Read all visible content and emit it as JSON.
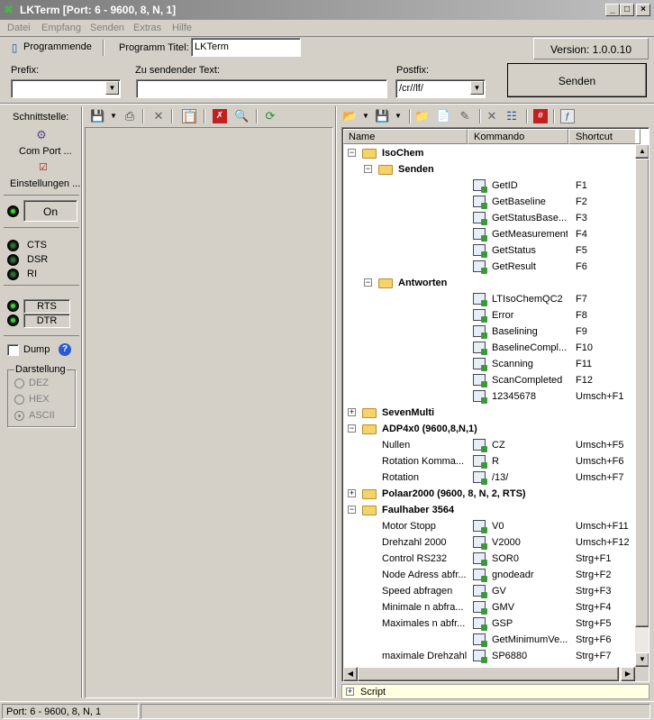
{
  "window": {
    "title": "LKTerm [Port: 6 - 9600, 8, N, 1]"
  },
  "menu": [
    "Datei",
    "Empfang",
    "Senden",
    "Extras",
    "Hilfe"
  ],
  "toolbar": {
    "programmende": "Programmende",
    "programm_titel_label": "Programm Titel:",
    "programm_titel_value": "LKTerm",
    "version": "Version: 1.0.0.10"
  },
  "send": {
    "prefix_label": "Prefix:",
    "prefix_value": "",
    "text_label": "Zu sendender Text:",
    "text_value": "",
    "postfix_label": "Postfix:",
    "postfix_value": "/cr//lf/",
    "send_button": "Senden"
  },
  "left_panel": {
    "schnittstelle": "Schnittstelle:",
    "com_port": "Com Port ...",
    "einstellungen": "Einstellungen ...",
    "on_button": "On",
    "cts": "CTS",
    "dsr": "DSR",
    "ri": "RI",
    "rts": "RTS",
    "dtr": "DTR",
    "dump": "Dump",
    "darstellung": "Darstellung",
    "dez": "DEZ",
    "hex": "HEX",
    "ascii": "ASCII"
  },
  "tree": {
    "headers": {
      "name": "Name",
      "kommando": "Kommando",
      "shortcut": "Shortcut"
    },
    "rows": [
      {
        "level": 0,
        "type": "folder",
        "expander": "−",
        "name": "IsoChem"
      },
      {
        "level": 1,
        "type": "folder",
        "expander": "−",
        "name": "Senden"
      },
      {
        "level": 2,
        "type": "cmd",
        "name": "",
        "kommando": "GetID",
        "shortcut": "F1"
      },
      {
        "level": 2,
        "type": "cmd",
        "name": "",
        "kommando": "GetBaseline",
        "shortcut": "F2"
      },
      {
        "level": 2,
        "type": "cmd",
        "name": "",
        "kommando": "GetStatusBase...",
        "shortcut": "F3"
      },
      {
        "level": 2,
        "type": "cmd",
        "name": "",
        "kommando": "GetMeasurement",
        "shortcut": "F4"
      },
      {
        "level": 2,
        "type": "cmd",
        "name": "",
        "kommando": "GetStatus",
        "shortcut": "F5"
      },
      {
        "level": 2,
        "type": "cmd",
        "name": "",
        "kommando": "GetResult",
        "shortcut": "F6"
      },
      {
        "level": 1,
        "type": "folder",
        "expander": "−",
        "name": "Antworten"
      },
      {
        "level": 2,
        "type": "cmd",
        "name": "",
        "kommando": "LTIsoChemQC2",
        "shortcut": "F7"
      },
      {
        "level": 2,
        "type": "cmd",
        "name": "",
        "kommando": "Error",
        "shortcut": "F8"
      },
      {
        "level": 2,
        "type": "cmd",
        "name": "",
        "kommando": "Baselining",
        "shortcut": "F9"
      },
      {
        "level": 2,
        "type": "cmd",
        "name": "",
        "kommando": "BaselineCompl...",
        "shortcut": "F10"
      },
      {
        "level": 2,
        "type": "cmd",
        "name": "",
        "kommando": "Scanning",
        "shortcut": "F11"
      },
      {
        "level": 2,
        "type": "cmd",
        "name": "",
        "kommando": "ScanCompleted",
        "shortcut": "F12"
      },
      {
        "level": 2,
        "type": "cmd",
        "name": "",
        "kommando": "12345678",
        "shortcut": "Umsch+F1"
      },
      {
        "level": 0,
        "type": "folder",
        "expander": "+",
        "name": "SevenMulti"
      },
      {
        "level": 0,
        "type": "folder",
        "expander": "−",
        "name": "ADP4x0 (9600,8,N,1)"
      },
      {
        "level": 1,
        "type": "cmd",
        "name": "Nullen",
        "kommando": "CZ",
        "shortcut": "Umsch+F5"
      },
      {
        "level": 1,
        "type": "cmd",
        "name": "Rotation Komma...",
        "kommando": "R",
        "shortcut": "Umsch+F6"
      },
      {
        "level": 1,
        "type": "cmd",
        "name": "Rotation",
        "kommando": "/13/",
        "shortcut": "Umsch+F7"
      },
      {
        "level": 0,
        "type": "folder",
        "expander": "+",
        "name": "Polaar2000 (9600, 8, N, 2, RTS)"
      },
      {
        "level": 0,
        "type": "folder",
        "expander": "−",
        "name": "Faulhaber 3564"
      },
      {
        "level": 1,
        "type": "cmd",
        "name": "Motor Stopp",
        "kommando": "V0",
        "shortcut": "Umsch+F11"
      },
      {
        "level": 1,
        "type": "cmd",
        "name": "Drehzahl 2000",
        "kommando": "V2000",
        "shortcut": "Umsch+F12"
      },
      {
        "level": 1,
        "type": "cmd",
        "name": "Control RS232",
        "kommando": "SOR0",
        "shortcut": "Strg+F1"
      },
      {
        "level": 1,
        "type": "cmd",
        "name": "Node Adress abfr...",
        "kommando": "gnodeadr",
        "shortcut": "Strg+F2"
      },
      {
        "level": 1,
        "type": "cmd",
        "name": "Speed abfragen",
        "kommando": "GV",
        "shortcut": "Strg+F3"
      },
      {
        "level": 1,
        "type": "cmd",
        "name": "Minimale n abfra...",
        "kommando": "GMV",
        "shortcut": "Strg+F4"
      },
      {
        "level": 1,
        "type": "cmd",
        "name": "Maximales n abfr...",
        "kommando": "GSP",
        "shortcut": "Strg+F5"
      },
      {
        "level": 1,
        "type": "cmd",
        "name": "",
        "kommando": "GetMinimumVe...",
        "shortcut": "Strg+F6"
      },
      {
        "level": 1,
        "type": "cmd",
        "name": "maximale Drehzahl",
        "kommando": "SP6880",
        "shortcut": "Strg+F7"
      }
    ]
  },
  "script": {
    "expander": "+",
    "label": "Script"
  },
  "statusbar": {
    "text": "Port: 6 - 9600, 8, N, 1"
  },
  "colors": {
    "title_start": "#7a7a7a",
    "title_end": "#c0c0c0",
    "selection": "#ffffe1"
  }
}
